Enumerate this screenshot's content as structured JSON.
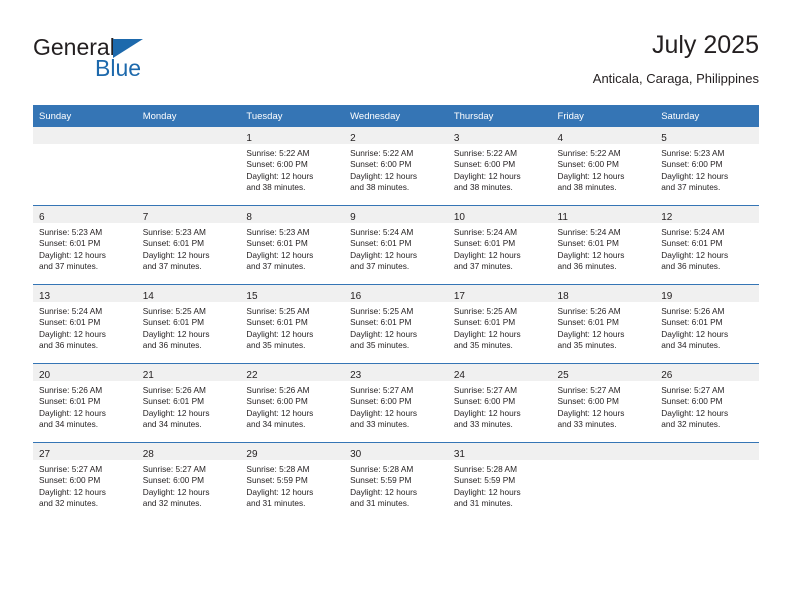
{
  "brand": {
    "name_part1": "General",
    "name_part2": "Blue",
    "triangle_icon": "triangle-icon",
    "color_primary": "#1d69ac",
    "color_dark": "#231f20"
  },
  "header": {
    "title": "July 2025",
    "subtitle": "Anticala, Caraga, Philippines"
  },
  "calendar": {
    "header_bg": "#3575b5",
    "daynum_band_bg": "#f0f0f0",
    "weekday_headers": [
      "Sunday",
      "Monday",
      "Tuesday",
      "Wednesday",
      "Thursday",
      "Friday",
      "Saturday"
    ],
    "weeks": [
      [
        {
          "day": "",
          "lines": []
        },
        {
          "day": "",
          "lines": []
        },
        {
          "day": "1",
          "lines": [
            "Sunrise: 5:22 AM",
            "Sunset: 6:00 PM",
            "Daylight: 12 hours",
            "and 38 minutes."
          ]
        },
        {
          "day": "2",
          "lines": [
            "Sunrise: 5:22 AM",
            "Sunset: 6:00 PM",
            "Daylight: 12 hours",
            "and 38 minutes."
          ]
        },
        {
          "day": "3",
          "lines": [
            "Sunrise: 5:22 AM",
            "Sunset: 6:00 PM",
            "Daylight: 12 hours",
            "and 38 minutes."
          ]
        },
        {
          "day": "4",
          "lines": [
            "Sunrise: 5:22 AM",
            "Sunset: 6:00 PM",
            "Daylight: 12 hours",
            "and 38 minutes."
          ]
        },
        {
          "day": "5",
          "lines": [
            "Sunrise: 5:23 AM",
            "Sunset: 6:00 PM",
            "Daylight: 12 hours",
            "and 37 minutes."
          ]
        }
      ],
      [
        {
          "day": "6",
          "lines": [
            "Sunrise: 5:23 AM",
            "Sunset: 6:01 PM",
            "Daylight: 12 hours",
            "and 37 minutes."
          ]
        },
        {
          "day": "7",
          "lines": [
            "Sunrise: 5:23 AM",
            "Sunset: 6:01 PM",
            "Daylight: 12 hours",
            "and 37 minutes."
          ]
        },
        {
          "day": "8",
          "lines": [
            "Sunrise: 5:23 AM",
            "Sunset: 6:01 PM",
            "Daylight: 12 hours",
            "and 37 minutes."
          ]
        },
        {
          "day": "9",
          "lines": [
            "Sunrise: 5:24 AM",
            "Sunset: 6:01 PM",
            "Daylight: 12 hours",
            "and 37 minutes."
          ]
        },
        {
          "day": "10",
          "lines": [
            "Sunrise: 5:24 AM",
            "Sunset: 6:01 PM",
            "Daylight: 12 hours",
            "and 37 minutes."
          ]
        },
        {
          "day": "11",
          "lines": [
            "Sunrise: 5:24 AM",
            "Sunset: 6:01 PM",
            "Daylight: 12 hours",
            "and 36 minutes."
          ]
        },
        {
          "day": "12",
          "lines": [
            "Sunrise: 5:24 AM",
            "Sunset: 6:01 PM",
            "Daylight: 12 hours",
            "and 36 minutes."
          ]
        }
      ],
      [
        {
          "day": "13",
          "lines": [
            "Sunrise: 5:24 AM",
            "Sunset: 6:01 PM",
            "Daylight: 12 hours",
            "and 36 minutes."
          ]
        },
        {
          "day": "14",
          "lines": [
            "Sunrise: 5:25 AM",
            "Sunset: 6:01 PM",
            "Daylight: 12 hours",
            "and 36 minutes."
          ]
        },
        {
          "day": "15",
          "lines": [
            "Sunrise: 5:25 AM",
            "Sunset: 6:01 PM",
            "Daylight: 12 hours",
            "and 35 minutes."
          ]
        },
        {
          "day": "16",
          "lines": [
            "Sunrise: 5:25 AM",
            "Sunset: 6:01 PM",
            "Daylight: 12 hours",
            "and 35 minutes."
          ]
        },
        {
          "day": "17",
          "lines": [
            "Sunrise: 5:25 AM",
            "Sunset: 6:01 PM",
            "Daylight: 12 hours",
            "and 35 minutes."
          ]
        },
        {
          "day": "18",
          "lines": [
            "Sunrise: 5:26 AM",
            "Sunset: 6:01 PM",
            "Daylight: 12 hours",
            "and 35 minutes."
          ]
        },
        {
          "day": "19",
          "lines": [
            "Sunrise: 5:26 AM",
            "Sunset: 6:01 PM",
            "Daylight: 12 hours",
            "and 34 minutes."
          ]
        }
      ],
      [
        {
          "day": "20",
          "lines": [
            "Sunrise: 5:26 AM",
            "Sunset: 6:01 PM",
            "Daylight: 12 hours",
            "and 34 minutes."
          ]
        },
        {
          "day": "21",
          "lines": [
            "Sunrise: 5:26 AM",
            "Sunset: 6:01 PM",
            "Daylight: 12 hours",
            "and 34 minutes."
          ]
        },
        {
          "day": "22",
          "lines": [
            "Sunrise: 5:26 AM",
            "Sunset: 6:00 PM",
            "Daylight: 12 hours",
            "and 34 minutes."
          ]
        },
        {
          "day": "23",
          "lines": [
            "Sunrise: 5:27 AM",
            "Sunset: 6:00 PM",
            "Daylight: 12 hours",
            "and 33 minutes."
          ]
        },
        {
          "day": "24",
          "lines": [
            "Sunrise: 5:27 AM",
            "Sunset: 6:00 PM",
            "Daylight: 12 hours",
            "and 33 minutes."
          ]
        },
        {
          "day": "25",
          "lines": [
            "Sunrise: 5:27 AM",
            "Sunset: 6:00 PM",
            "Daylight: 12 hours",
            "and 33 minutes."
          ]
        },
        {
          "day": "26",
          "lines": [
            "Sunrise: 5:27 AM",
            "Sunset: 6:00 PM",
            "Daylight: 12 hours",
            "and 32 minutes."
          ]
        }
      ],
      [
        {
          "day": "27",
          "lines": [
            "Sunrise: 5:27 AM",
            "Sunset: 6:00 PM",
            "Daylight: 12 hours",
            "and 32 minutes."
          ]
        },
        {
          "day": "28",
          "lines": [
            "Sunrise: 5:27 AM",
            "Sunset: 6:00 PM",
            "Daylight: 12 hours",
            "and 32 minutes."
          ]
        },
        {
          "day": "29",
          "lines": [
            "Sunrise: 5:28 AM",
            "Sunset: 5:59 PM",
            "Daylight: 12 hours",
            "and 31 minutes."
          ]
        },
        {
          "day": "30",
          "lines": [
            "Sunrise: 5:28 AM",
            "Sunset: 5:59 PM",
            "Daylight: 12 hours",
            "and 31 minutes."
          ]
        },
        {
          "day": "31",
          "lines": [
            "Sunrise: 5:28 AM",
            "Sunset: 5:59 PM",
            "Daylight: 12 hours",
            "and 31 minutes."
          ]
        },
        {
          "day": "",
          "lines": []
        },
        {
          "day": "",
          "lines": []
        }
      ]
    ]
  }
}
